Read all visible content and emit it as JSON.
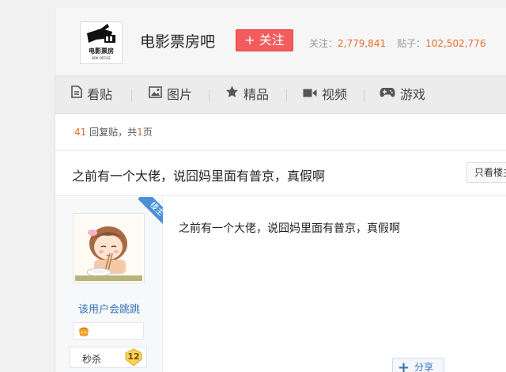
{
  "forum": {
    "logo_text": "电影票房",
    "logo_subtext": "BOX OFFICE",
    "name": "电影票房吧",
    "follow_label": "+ 关注",
    "followers_label": "关注：",
    "followers_count": "2,779,841",
    "posts_label": "贴子：",
    "posts_count": "102,502,776"
  },
  "nav": {
    "items": [
      {
        "label": "看贴",
        "icon": "document-icon"
      },
      {
        "label": "图片",
        "icon": "image-icon"
      },
      {
        "label": "精品",
        "icon": "star-icon"
      },
      {
        "label": "视频",
        "icon": "video-camera-icon"
      },
      {
        "label": "游戏",
        "icon": "gamepad-icon"
      }
    ]
  },
  "thread": {
    "reply_count": "41",
    "reply_text": " 回复贴，共",
    "page_count": "1",
    "page_suffix": "页",
    "title": "之前有一个大佬，说囧妈里面有普京，真假啊",
    "only_op_label": "只看楼主"
  },
  "post": {
    "op_badge": "楼主",
    "username": "该用户会跳跳",
    "level_name": "秒杀",
    "level_number": "12",
    "content": "之前有一个大佬，说囧妈里面有普京，真假啊",
    "share_label": "分享"
  },
  "colors": {
    "follow_button": "#f25c5c",
    "count_orange": "#e46d2d",
    "link_blue": "#3872b5",
    "ribbon_blue": "#4a90d9"
  }
}
